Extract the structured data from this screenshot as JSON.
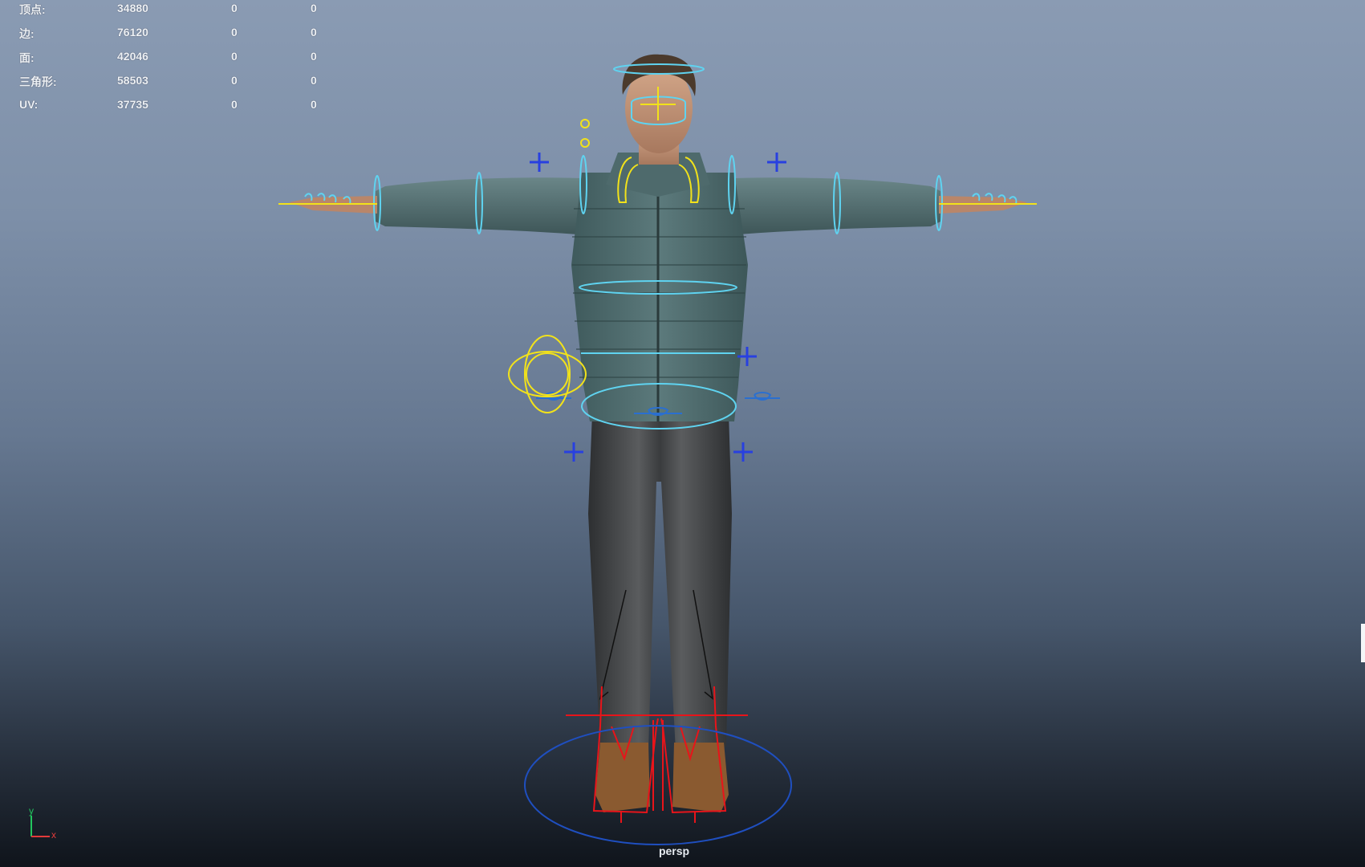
{
  "stats": {
    "rows": [
      {
        "label": "顶点:",
        "v1": "34880",
        "v2": "0",
        "v3": "0"
      },
      {
        "label": "边:",
        "v1": "76120",
        "v2": "0",
        "v3": "0"
      },
      {
        "label": "面:",
        "v1": "42046",
        "v2": "0",
        "v3": "0"
      },
      {
        "label": "三角形:",
        "v1": "58503",
        "v2": "0",
        "v3": "0"
      },
      {
        "label": "UV:",
        "v1": "37735",
        "v2": "0",
        "v3": "0"
      }
    ]
  },
  "viewport": {
    "camera_name": "persp",
    "axis_y": "y",
    "axis_x": "x"
  },
  "colors": {
    "fk_control": "#5fd3f0",
    "ik_control": "#f2e21a",
    "foot_control": "#e8141a",
    "root_control": "#1f4fc0",
    "pole_vector": "#2840e0"
  }
}
